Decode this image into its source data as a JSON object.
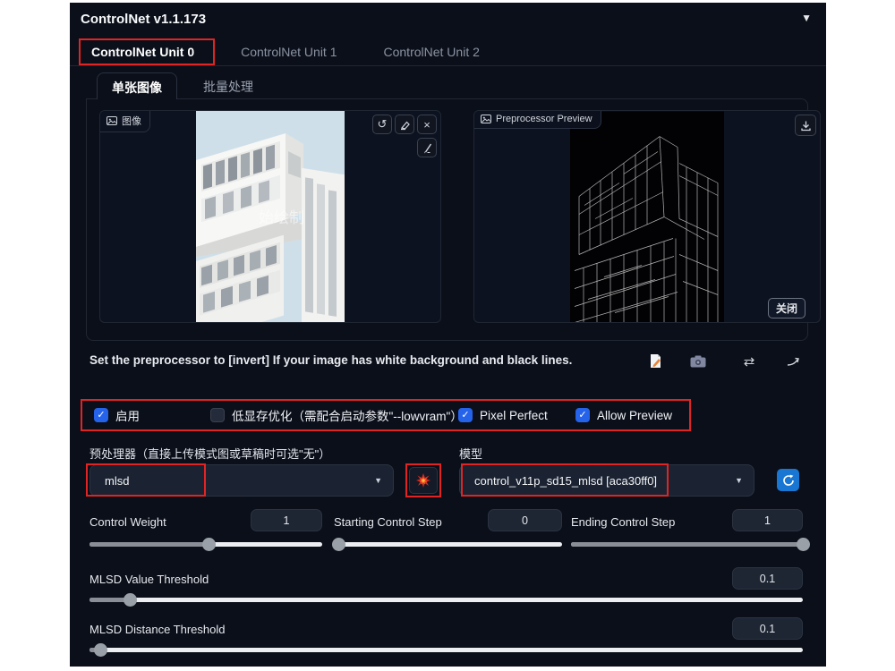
{
  "header": {
    "title": "ControlNet v1.1.173",
    "collapse_icon": "▼"
  },
  "unit_tabs": [
    {
      "label": "ControlNet Unit 0",
      "active": true
    },
    {
      "label": "ControlNet Unit 1",
      "active": false
    },
    {
      "label": "ControlNet Unit 2",
      "active": false
    }
  ],
  "mode_tabs": [
    {
      "label": "单张图像",
      "active": true
    },
    {
      "label": "批量处理",
      "active": false
    }
  ],
  "image_panel": {
    "label": "图像",
    "watermark": "始绘制"
  },
  "preview_panel": {
    "label": "Preprocessor Preview",
    "close_label": "关闭"
  },
  "notice": {
    "text": "Set the preprocessor to [invert] If your image has white background and black lines."
  },
  "checkboxes": [
    {
      "label": "启用",
      "checked": true
    },
    {
      "label": "低显存优化（需配合启动参数\"--lowvram\"）",
      "checked": false
    },
    {
      "label": "Pixel Perfect",
      "checked": true
    },
    {
      "label": "Allow Preview",
      "checked": true
    }
  ],
  "preprocessor": {
    "label": "预处理器（直接上传模式图或草稿时可选\"无\"）",
    "value": "mlsd"
  },
  "model": {
    "label": "模型",
    "value": "control_v11p_sd15_mlsd [aca30ff0]"
  },
  "sliders": [
    {
      "label": "Control Weight",
      "value": "1",
      "percent": 51
    },
    {
      "label": "Starting Control Step",
      "value": "0",
      "percent": 2
    },
    {
      "label": "Ending Control Step",
      "value": "1",
      "percent": 100
    },
    {
      "label": "MLSD Value Threshold",
      "value": "0.1",
      "percent": 5.6
    },
    {
      "label": "MLSD Distance Threshold",
      "value": "0.1",
      "percent": 1.5
    }
  ],
  "icons": {
    "check": "✓",
    "caret_down": "▼",
    "undo": "↺",
    "close": "×",
    "swap": "⇄"
  },
  "colors": {
    "panel_bg": "#0b0f19",
    "accent_blue": "#2563eb",
    "annotation_red": "#e02424",
    "refresh_blue": "#1976d2",
    "slider_fill": "#8a8e96",
    "slider_track": "#eceef1"
  }
}
